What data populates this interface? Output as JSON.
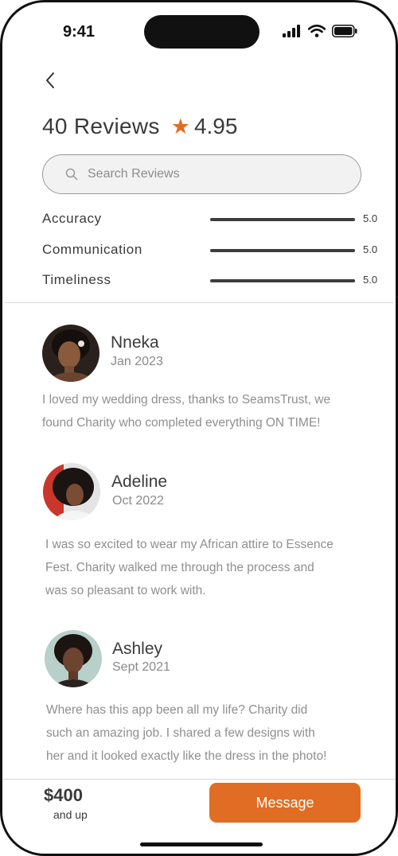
{
  "status_bar": {
    "time": "9:41"
  },
  "header": {
    "title": "40 Reviews",
    "rating": "4.95",
    "star_color": "#e06d23"
  },
  "search": {
    "placeholder": "Search Reviews",
    "value": ""
  },
  "metrics": [
    {
      "label": "Accuracy",
      "value": "5.0",
      "fraction": 1.0
    },
    {
      "label": "Communication",
      "value": "5.0",
      "fraction": 1.0
    },
    {
      "label": "Timeliness",
      "value": "5.0",
      "fraction": 1.0
    }
  ],
  "reviews": [
    {
      "name": "Nneka",
      "date": "Jan 2023",
      "lines": [
        "I loved my wedding dress, thanks to SeamsTrust, we",
        "found Charity who completed everything ON TIME!"
      ]
    },
    {
      "name": "Adeline",
      "date": "Oct 2022",
      "lines": [
        "I was so excited to wear my African attire to Essence",
        "Fest. Charity walked me through the process and",
        "was so pleasant to work with."
      ]
    },
    {
      "name": "Ashley",
      "date": "Sept 2021",
      "lines": [
        "Where has this app been all my life? Charity did",
        "such an amazing job. I shared a few designs with",
        "her and it looked exactly like the dress in the photo!"
      ]
    }
  ],
  "footer": {
    "price": "$400",
    "price_sub": "and up",
    "button_label": "Message",
    "accent": "#e06d23"
  }
}
